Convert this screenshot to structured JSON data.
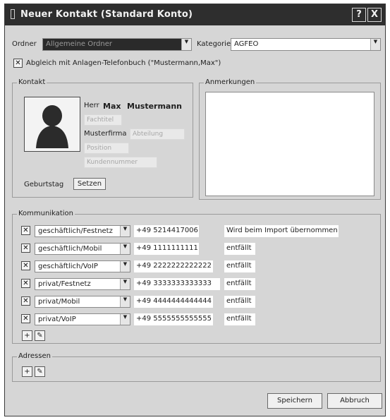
{
  "window": {
    "title": "Neuer Kontakt (Standard Konto)",
    "help_label": "?",
    "close_label": "X"
  },
  "top": {
    "ordner_label": "Ordner",
    "ordner_value": "Allgemeine Ordner",
    "kategorie_label": "Kategorie",
    "kategorie_value": "AGFEO",
    "sync_checked": true,
    "sync_label": "Abgleich mit Anlagen-Telefonbuch (\"Mustermann,Max\")"
  },
  "kontakt": {
    "group_label": "Kontakt",
    "anrede": "Herr",
    "vorname": "Max",
    "nachname": "Mustermann",
    "titel_placeholder": "Fachtitel",
    "firma_value": "Musterfirma",
    "abteilung_placeholder": "Abteilung",
    "position_placeholder": "Position",
    "kundennummer_placeholder": "Kundennummer",
    "geburtstag_label": "Geburtstag",
    "setzen_label": "Setzen"
  },
  "anmerkungen": {
    "group_label": "Anmerkungen",
    "value": ""
  },
  "kommunikation": {
    "group_label": "Kommunikation",
    "rows": [
      {
        "type": "geschäftlich/Festnetz",
        "number": "+49 5214417006",
        "note": "Wird beim Import übernommen",
        "checked": true
      },
      {
        "type": "geschäftlich/Mobil",
        "number": "+49 1111111111",
        "note": "entfällt",
        "checked": true
      },
      {
        "type": "geschäftlich/VoIP",
        "number": "+49 2222222222222",
        "note": "entfällt",
        "checked": true
      },
      {
        "type": "privat/Festnetz",
        "number": "+49 3333333333333",
        "note": "entfällt",
        "checked": true
      },
      {
        "type": "privat/Mobil",
        "number": "+49 4444444444444",
        "note": "entfällt",
        "checked": true
      },
      {
        "type": "privat/VoIP",
        "number": "+49 5555555555555",
        "note": "entfällt",
        "checked": true
      }
    ],
    "add_icon": "plus-icon",
    "edit_icon": "pencil-icon"
  },
  "adressen": {
    "group_label": "Adressen",
    "add_icon": "plus-icon",
    "edit_icon": "pencil-icon"
  },
  "footer": {
    "save_label": "Speichern",
    "cancel_label": "Abbruch"
  },
  "colors": {
    "titlebar": "#2e2e2e",
    "dialog": "#d6d6d6",
    "field": "#ffffff"
  }
}
